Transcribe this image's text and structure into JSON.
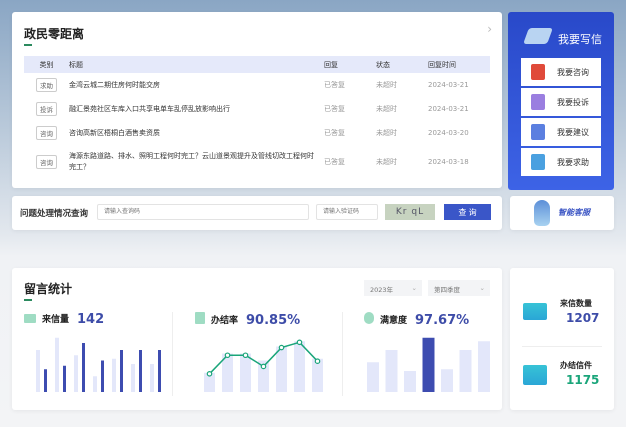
{
  "panel": {
    "title": "政民零距离",
    "more_icon": "chevron-right-icon",
    "columns": [
      "类别",
      "标题",
      "回复",
      "状态",
      "回复时间"
    ],
    "rows": [
      {
        "category": "求助",
        "title": "金湾云城二期住房何时能交房",
        "reply": "已答复",
        "status": "未超时",
        "time": "2024-03-21"
      },
      {
        "category": "投诉",
        "title": "融汇景苑社区车库入口共享电单车乱停乱放影响出行",
        "reply": "已答复",
        "status": "未超时",
        "time": "2024-03-21"
      },
      {
        "category": "咨询",
        "title": "咨询高新区梧桐白酒售卖资质",
        "reply": "已答复",
        "status": "未超时",
        "time": "2024-03-20"
      },
      {
        "category": "咨询",
        "title": "海源东路道路、排水、照明工程何时完工？云山道景观提升及管线切改工程何时完工？",
        "reply": "已答复",
        "status": "未超时",
        "time": "2024-03-18"
      }
    ]
  },
  "query": {
    "label": "问题处理情况查询",
    "code_placeholder": "请输入查询码",
    "verify_placeholder": "请输入验证码",
    "captcha": "Kr qL",
    "button": "查 询"
  },
  "smart_service": {
    "label": "智能客服"
  },
  "write": {
    "title": "我要写信",
    "buttons": [
      {
        "label": "我要咨询",
        "color": "#e04a3a"
      },
      {
        "label": "我要投诉",
        "color": "#9a7ee0"
      },
      {
        "label": "我要建议",
        "color": "#5b7fe0"
      },
      {
        "label": "我要求助",
        "color": "#4aa0e0"
      }
    ]
  },
  "stats": {
    "title": "留言统计",
    "year": "2023年",
    "quarter": "第四季度",
    "letters": {
      "label": "来信量",
      "value": "142"
    },
    "completion": {
      "label": "办结率",
      "value": "90.85%"
    },
    "satisfaction": {
      "label": "满意度",
      "value": "97.67%"
    }
  },
  "summary": {
    "received": {
      "label": "来信数量",
      "value": "1207"
    },
    "done": {
      "label": "办结信件",
      "value": "1175"
    }
  },
  "colors": {
    "accent": "#3a56c8",
    "green": "#1aa57a",
    "light_bar": "#e3e7fa",
    "dark_bar": "#3d4cb0"
  },
  "chart_data": [
    {
      "type": "bar",
      "note_units": "relative",
      "light": [
        120,
        155,
        105,
        45,
        95,
        80,
        80
      ],
      "dark": [
        65,
        75,
        140,
        90,
        120,
        120,
        120
      ]
    },
    {
      "type": "line",
      "bars": [
        55,
        110,
        110,
        90,
        130,
        145,
        95
      ],
      "values": [
        52,
        105,
        105,
        73,
        127,
        142,
        88
      ]
    },
    {
      "type": "bar",
      "values": [
        85,
        120,
        60,
        155,
        65,
        120,
        145
      ],
      "highlight_index": 3
    }
  ]
}
